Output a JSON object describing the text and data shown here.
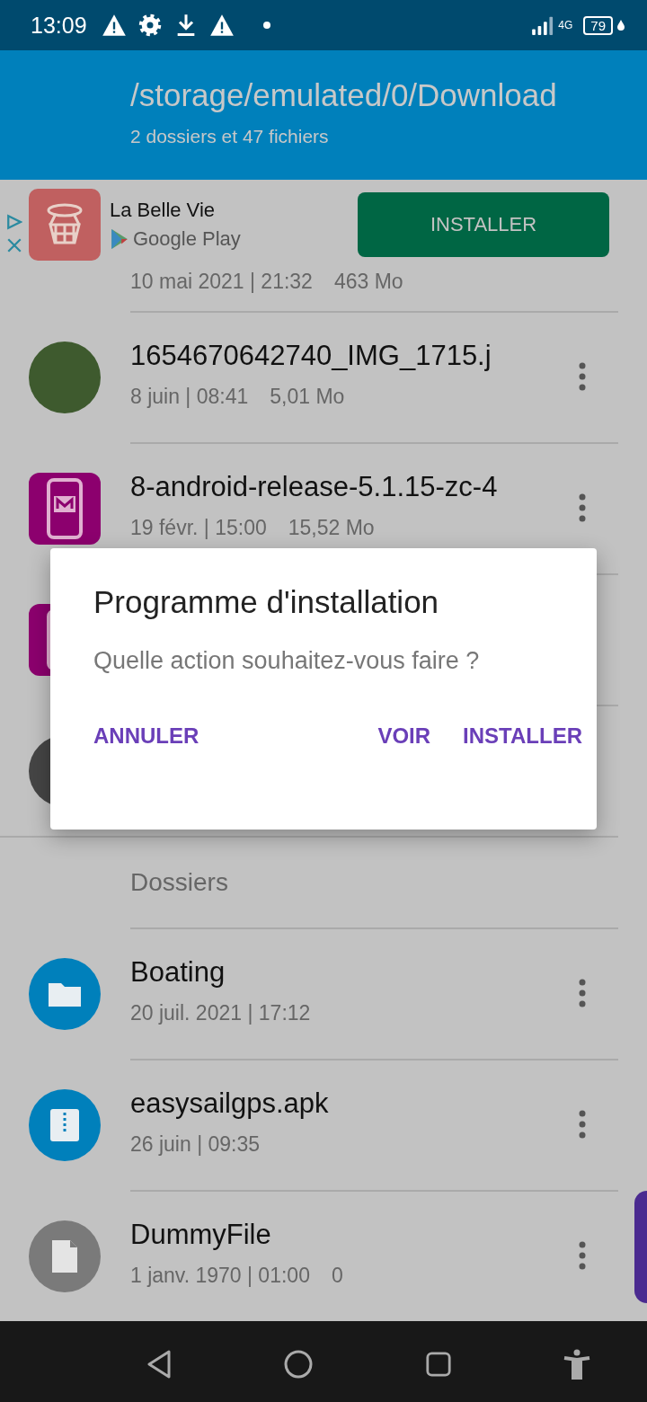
{
  "status_bar": {
    "time": "13:09",
    "network": "4G",
    "battery": "79"
  },
  "header": {
    "path": "/storage/emulated/0/Download",
    "summary": "2 dossiers et 47 fichiers"
  },
  "ad": {
    "app_name": "La Belle Vie",
    "store": "Google Play",
    "button": "INSTALLER"
  },
  "partial_row": {
    "date": "10 mai 2021 | 21:32",
    "size": "463 Mo"
  },
  "files": [
    {
      "kind": "photo",
      "name": "1654670642740_IMG_1715.j",
      "date": "8 juin | 08:41",
      "size": "5,01 Mo"
    },
    {
      "kind": "app",
      "name": "8-android-release-5.1.15-zc-4",
      "date": "19 févr. | 15:00",
      "size": "15,52 Mo"
    },
    {
      "kind": "app"
    },
    {
      "kind": "dark"
    }
  ],
  "section": "Dossiers",
  "folders": [
    {
      "kind": "folder",
      "name": "Boating",
      "date": "20 juil. 2021 | 17:12"
    },
    {
      "kind": "archive",
      "name": "easysailgps.apk",
      "date": "26 juin | 09:35"
    },
    {
      "kind": "doc",
      "name": "DummyFile",
      "date": "1 janv. 1970 | 01:00",
      "size": "0"
    }
  ],
  "dialog": {
    "title": "Programme d'installation",
    "message": "Quelle action souhaitez-vous faire ?",
    "buttons": [
      "ANNULER",
      "VOIR",
      "INSTALLER"
    ]
  }
}
